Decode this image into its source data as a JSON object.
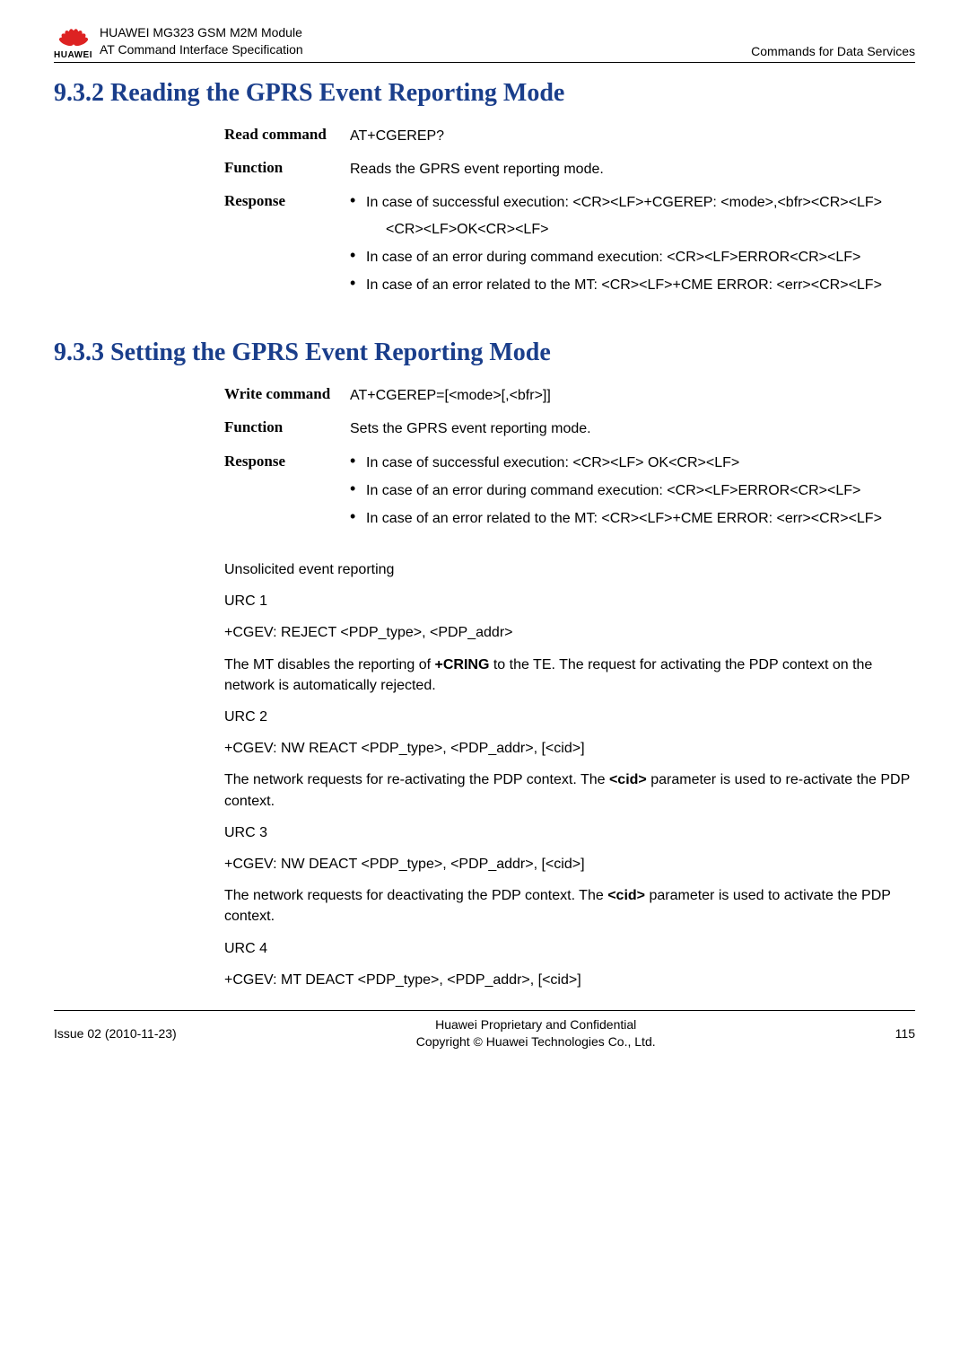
{
  "header": {
    "product_line1": "HUAWEI MG323 GSM M2M Module",
    "product_line2": "AT Command Interface Specification",
    "right": "Commands for Data Services",
    "brand": "HUAWEI"
  },
  "section_932": {
    "title": "9.3.2 Reading the GPRS Event Reporting Mode",
    "rows": {
      "read_label": "Read command",
      "read_value": "AT+CGEREP?",
      "function_label": "Function",
      "function_value": "Reads the GPRS event reporting mode.",
      "response_label": "Response",
      "r1": "In case of successful execution: <CR><LF>+CGEREP: <mode>,<bfr><CR><LF>",
      "r1_sub": "<CR><LF>OK<CR><LF>",
      "r2": "In case of an error during command execution: <CR><LF>ERROR<CR><LF>",
      "r3": "In case of an error related to the MT: <CR><LF>+CME ERROR: <err><CR><LF>"
    }
  },
  "section_933": {
    "title": "9.3.3 Setting the GPRS Event Reporting Mode",
    "rows": {
      "write_label": "Write command",
      "write_value": "AT+CGEREP=[<mode>[,<bfr>]]",
      "function_label": "Function",
      "function_value": "Sets the GPRS event reporting mode.",
      "response_label": "Response",
      "r1": "In case of successful execution: <CR><LF> OK<CR><LF>",
      "r2": "In case of an error during command execution: <CR><LF>ERROR<CR><LF>",
      "r3": "In case of an error related to the MT: <CR><LF>+CME ERROR: <err><CR><LF>"
    }
  },
  "body": {
    "unsolicited": "Unsolicited event reporting",
    "urc1_label": "URC 1",
    "urc1_cmd": "+CGEV: REJECT <PDP_type>, <PDP_addr>",
    "urc1_desc_a": "The MT disables the reporting of ",
    "urc1_desc_bold": "+CRING",
    "urc1_desc_b": " to the TE. The request for activating the PDP context on the network is automatically rejected.",
    "urc2_label": "URC 2",
    "urc2_cmd": "+CGEV: NW REACT <PDP_type>, <PDP_addr>, [<cid>]",
    "urc2_desc_a": "The network requests for re-activating the PDP context. The ",
    "urc2_desc_bold": "<cid>",
    "urc2_desc_b": " parameter is used to re-activate the PDP context.",
    "urc3_label": "URC 3",
    "urc3_cmd": "+CGEV: NW DEACT <PDP_type>, <PDP_addr>, [<cid>]",
    "urc3_desc_a": "The network requests for deactivating the PDP context. The ",
    "urc3_desc_bold": "<cid>",
    "urc3_desc_b": " parameter is used to activate the PDP context.",
    "urc4_label": "URC 4",
    "urc4_cmd": "+CGEV: MT DEACT <PDP_type>, <PDP_addr>, [<cid>]"
  },
  "footer": {
    "left": "Issue 02 (2010-11-23)",
    "center1": "Huawei Proprietary and Confidential",
    "center2": "Copyright © Huawei Technologies Co., Ltd.",
    "right": "115"
  }
}
